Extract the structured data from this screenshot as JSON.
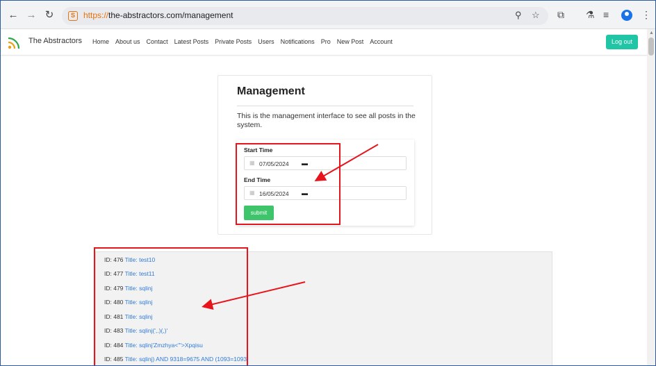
{
  "browser": {
    "url_scheme": "https://",
    "url_rest": "the-abstractors.com/management",
    "icons": [
      "back-icon",
      "forward-icon",
      "reload-icon",
      "site-info-icon",
      "zoom-icon",
      "star-icon",
      "extensions-icon",
      "labs-icon",
      "media-icon",
      "profile-icon",
      "menu-icon"
    ]
  },
  "site": {
    "brand": "The Abstractors",
    "nav": [
      "Home",
      "About us",
      "Contact",
      "Latest Posts",
      "Private Posts",
      "Users",
      "Notifications",
      "Pro",
      "New Post",
      "Account"
    ],
    "logout": "Log out"
  },
  "management": {
    "title": "Management",
    "description": "This is the management interface to see all posts in the system.",
    "start_label": "Start Time",
    "start_value": "07/05/2024",
    "end_label": "End Time",
    "end_value": "16/05/2024",
    "submit": "submit"
  },
  "results": [
    {
      "id": "ID: 476",
      "title": "Title: test10"
    },
    {
      "id": "ID: 477",
      "title": "Title: test11"
    },
    {
      "id": "ID: 479",
      "title": "Title: sqlinj"
    },
    {
      "id": "ID: 480",
      "title": "Title: sqlinj"
    },
    {
      "id": "ID: 481",
      "title": "Title: sqlinj"
    },
    {
      "id": "ID: 483",
      "title": "Title: sqlinj(',.)(,)'"
    },
    {
      "id": "ID: 484",
      "title": "Title: sqlinj'Zmzhya<'\">Xpqisu"
    },
    {
      "id": "ID: 485",
      "title": "Title: sqlinj) AND 9318=9675 AND (1093=1093"
    }
  ],
  "colors": {
    "accent_teal": "#1fc5a5",
    "submit_green": "#3ec56b",
    "link_blue": "#2f7bd8",
    "annotation_red": "#e8141b"
  }
}
